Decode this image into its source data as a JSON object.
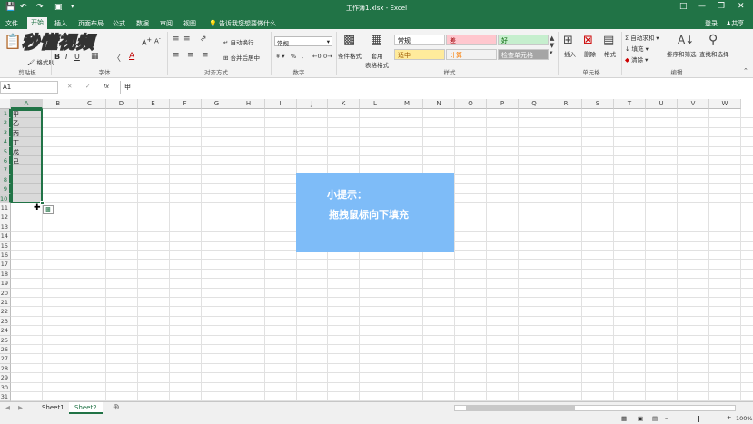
{
  "window": {
    "title": "工作簿1.xlsx - Excel"
  },
  "tabs": [
    {
      "label": "文件"
    },
    {
      "label": "开始"
    },
    {
      "label": "插入"
    },
    {
      "label": "页面布局"
    },
    {
      "label": "公式"
    },
    {
      "label": "数据"
    },
    {
      "label": "审阅"
    },
    {
      "label": "视图"
    }
  ],
  "tellme": "告诉我您想要做什么...",
  "account": {
    "login": "登录",
    "share": "共享"
  },
  "ribbon": {
    "clipboard": {
      "label": "剪贴板",
      "format_painter": "格式刷"
    },
    "font": {
      "label": "字体"
    },
    "alignment": {
      "label": "对齐方式",
      "wrap": "自动换行",
      "merge": "合并后居中"
    },
    "number": {
      "label": "数字",
      "format": "常规"
    },
    "styles": {
      "label": "样式",
      "conditional": "条件格式",
      "table": "套用\n表格格式",
      "cells": [
        {
          "label": "常规",
          "bg": "#ffffff",
          "fg": "#000000"
        },
        {
          "label": "差",
          "bg": "#ffc7ce",
          "fg": "#9c0006"
        },
        {
          "label": "好",
          "bg": "#c6efce",
          "fg": "#006100"
        },
        {
          "label": "适中",
          "bg": "#ffeb9c",
          "fg": "#9c5700"
        },
        {
          "label": "计算",
          "bg": "#f2f2f2",
          "fg": "#fa7d00"
        },
        {
          "label": "检查单元格",
          "bg": "#a5a5a5",
          "fg": "#ffffff"
        }
      ]
    },
    "cells": {
      "label": "单元格",
      "insert": "插入",
      "delete": "删除",
      "format": "格式"
    },
    "editing": {
      "label": "编辑",
      "autosum": "自动求和",
      "fill": "填充",
      "clear": "清除",
      "sort": "排序和筛选",
      "find": "查找和选择"
    }
  },
  "formula_bar": {
    "name_box": "A1",
    "fx": "fx",
    "value": "甲"
  },
  "columns": [
    "A",
    "B",
    "C",
    "D",
    "E",
    "F",
    "G",
    "H",
    "I",
    "J",
    "K",
    "L",
    "M",
    "N",
    "O",
    "P",
    "Q",
    "R",
    "S",
    "T",
    "U",
    "V",
    "W"
  ],
  "rows": [
    "1",
    "2",
    "3",
    "4",
    "5",
    "6",
    "7",
    "8",
    "9",
    "10",
    "11",
    "12",
    "13",
    "14",
    "15",
    "16",
    "17",
    "18",
    "19",
    "20",
    "21",
    "22",
    "23",
    "24",
    "25",
    "26",
    "27",
    "28",
    "29",
    "30",
    "31"
  ],
  "cells_a": [
    "甲",
    "乙",
    "丙",
    "丁",
    "戊",
    "己"
  ],
  "hint": {
    "line1": "小提示：",
    "line2": "拖拽鼠标向下填充"
  },
  "sheets": [
    {
      "label": "Sheet1"
    },
    {
      "label": "Sheet2"
    }
  ],
  "status": {
    "zoom": "100%"
  },
  "logo_text": "秒懂视频"
}
